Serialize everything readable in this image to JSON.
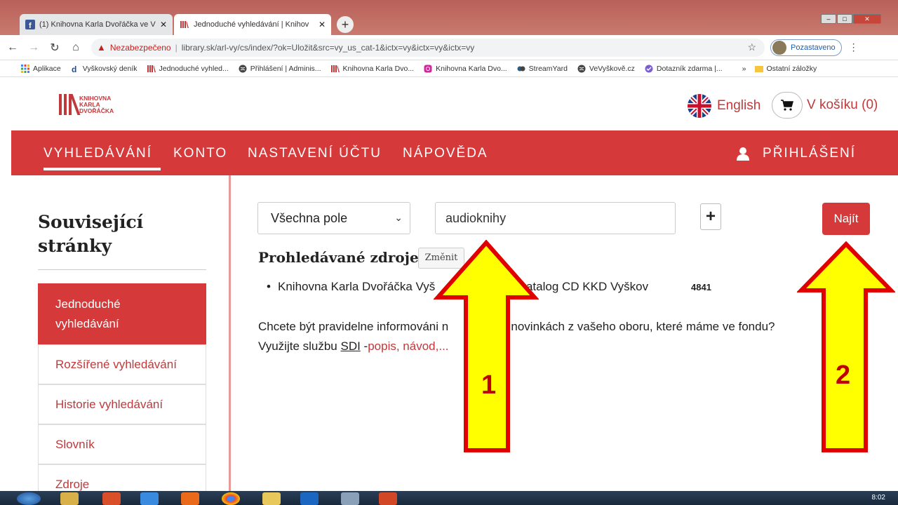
{
  "browser": {
    "tabs": [
      {
        "title": "(1) Knihovna Karla Dvořáčka ve V",
        "active": false
      },
      {
        "title": "Jednoduché vyhledávání | Knihov",
        "active": true
      }
    ],
    "address": {
      "warning": "Nezabezpečeno",
      "separator": "|",
      "url": "library.sk/arl-vy/cs/index/?ok=Uložit&src=vy_us_cat-1&ictx=vy&ictx=vy&ictx=vy"
    },
    "profile_label": "Pozastaveno",
    "bookmarks": [
      {
        "label": "Aplikace",
        "icon": "apps-grid-icon"
      },
      {
        "label": "Vyškovský deník",
        "icon": "denik-icon"
      },
      {
        "label": "Jednoduché vyhled...",
        "icon": "library-icon"
      },
      {
        "label": "Přihlášení | Adminis...",
        "icon": "globe-icon"
      },
      {
        "label": "Knihovna Karla Dvo...",
        "icon": "library-icon"
      },
      {
        "label": "Knihovna Karla Dvo...",
        "icon": "instagram-icon"
      },
      {
        "label": "StreamYard",
        "icon": "streamyard-icon"
      },
      {
        "label": "VeVyškově.cz",
        "icon": "globe-icon"
      },
      {
        "label": "Dotazník zdarma |...",
        "icon": "survey-icon"
      }
    ],
    "bookmarks_more": "»",
    "other_bookmarks": "Ostatní záložky"
  },
  "header": {
    "logo_lines": [
      "KNIHOVNA",
      "KARLA",
      "DVOŘÁČKA"
    ],
    "language": "English",
    "cart": "V košíku (0)"
  },
  "nav": {
    "items": [
      "VYHLEDÁVÁNÍ",
      "KONTO",
      "NASTAVENÍ ÚČTU",
      "NÁPOVĚDA"
    ],
    "login": "PŘIHLÁŠENÍ"
  },
  "sidebar": {
    "title_line1": "Související",
    "title_line2": "stránky",
    "items": [
      {
        "label_line1": "Jednoduché",
        "label_line2": "vyhledávání",
        "active": true
      },
      {
        "label_line1": "Rozšířené vyhledávání",
        "active": false
      },
      {
        "label_line1": "Historie vyhledávání",
        "active": false
      },
      {
        "label_line1": "Slovník",
        "active": false
      },
      {
        "label_line1": "Zdroje",
        "active": false
      }
    ]
  },
  "search": {
    "field_select": "Všechna pole",
    "query": "audioknihy",
    "add_label": "+",
    "find_label": "Najít",
    "sources_heading": "Prohledávané zdroje",
    "change_label": "Změnit",
    "source_prefix": "Knihovna Karla Dvořáčka Vyš",
    "source_suffix": "line katalog CD KKD Vyškov",
    "source_count": "4841",
    "info_line1_a": "Chcete být pravidelne informováni n",
    "info_line1_b": "o novinkách z vašeho oboru, které máme ve fondu?",
    "info_line2_a": "Využijte službu ",
    "info_line2_sdi": "SDI",
    "info_line2_sep": " -",
    "info_line2_link": "popis, návod,..."
  },
  "annotations": {
    "arrow1_number": "1",
    "arrow2_number": "2",
    "arrow_fill": "#ffff00",
    "arrow_stroke": "#e00000"
  },
  "taskbar": {
    "clock": "8:02"
  },
  "colors": {
    "brand_red": "#d5393a",
    "link_red": "#c0393b"
  }
}
